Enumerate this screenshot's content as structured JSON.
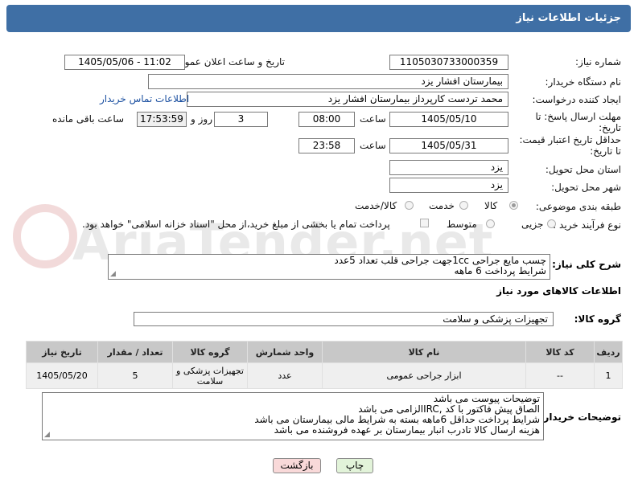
{
  "header": {
    "title": "جزئیات اطلاعات نیاز"
  },
  "fields": {
    "need_number_label": "شماره نیاز:",
    "need_number": "1105030733000359",
    "announce_label": "تاریخ و ساعت اعلان عمومی:",
    "announce_value": "1405/05/06 - 11:02",
    "buyer_org_label": "نام دستگاه خریدار:",
    "buyer_org": "بیمارستان افشار یزد",
    "creator_label": "ایجاد کننده درخواست:",
    "creator": "محمد تردست کارپرداز بیمارستان افشار یزد",
    "contact_link": "اطلاعات تماس خریدار",
    "reply_deadline_label_1": "مهلت ارسال پاسخ: تا",
    "reply_deadline_label_2": "تاریخ:",
    "reply_date": "1405/05/10",
    "time_label": "ساعت",
    "reply_time": "08:00",
    "days_value": "3",
    "days_label": "روز و",
    "remaining_time": "17:53:59",
    "remaining_label": "ساعت باقی مانده",
    "price_deadline_label_1": "حداقل تاریخ اعتبار قیمت:",
    "price_deadline_label_2": "تا تاریخ:",
    "price_date": "1405/05/31",
    "price_time": "23:58",
    "province_label": "استان محل تحویل:",
    "province": "یزد",
    "city_label": "شهر محل تحویل:",
    "city": "یزد",
    "category_label": "طبقه بندی موضوعی:",
    "category_options": [
      "کالا",
      "خدمت",
      "کالا/خدمت"
    ],
    "process_label": "نوع فرآیند خرید :",
    "process_options": [
      "جزیی",
      "متوسط"
    ],
    "payment_note": "پرداخت تمام یا بخشی از مبلغ خرید،از محل \"اسناد خزانه اسلامی\" خواهد بود."
  },
  "description": {
    "label": "شرح کلی نیاز:",
    "line1": "چسب مایع جراحی 1ccجهت جراحی قلب تعداد 5عدد",
    "line2": "شرایط پرداخت 6 ماهه"
  },
  "goods_section": {
    "title": "اطلاعات کالاهای مورد نیاز",
    "group_label": "گروه کالا:",
    "group_value": "تجهیزات پزشکی و سلامت"
  },
  "table": {
    "headers": [
      "ردیف",
      "کد کالا",
      "نام کالا",
      "واحد شمارش",
      "گروه کالا",
      "تعداد / مقدار",
      "تاریخ نیاز"
    ],
    "rows": [
      [
        "1",
        "--",
        "ابزار جراحی عمومی",
        "عدد",
        "تجهیزات پزشکی و سلامت",
        "5",
        "1405/05/20"
      ]
    ]
  },
  "buyer_notes": {
    "label": "توضیحات خریدار:",
    "lines": [
      "توضیحات پیوست می باشد",
      "الصاق پیش فاکتور با کد  ,IRCالزامی می باشد",
      "شرایط پرداخت حداقل 6ماهه بسته به شرایط مالی بیمارستان می باشد",
      "هزینه ارسال کالا تادرب انبار بیمارستان بر عهده فروشنده می باشد"
    ]
  },
  "buttons": {
    "print": "چاپ",
    "back": "بازگشت"
  },
  "watermark": "AriaTender.net",
  "colors": {
    "header": "#3f6fa5",
    "link": "#1a4fa0",
    "back_button": "#f9d9d9",
    "print_button": "#e2f3d9"
  }
}
